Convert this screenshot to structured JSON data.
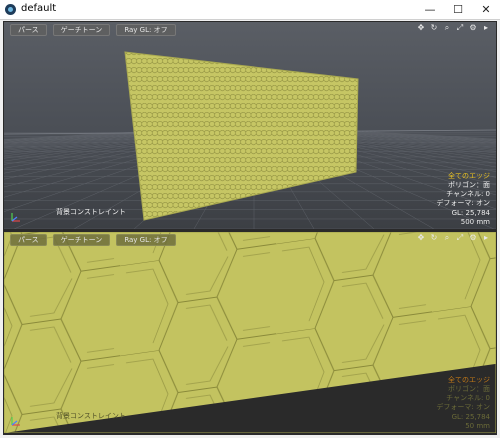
{
  "window": {
    "title": "default",
    "minimize": "—",
    "maximize": "☐",
    "close": "✕"
  },
  "viewport_top": {
    "toolbar": [
      "パース",
      "ゲーチトーン",
      "Ray GL: オフ"
    ],
    "bottom_label": "背景コンストレイント",
    "info": [
      "全てのエッジ",
      "ポリゴン：面",
      "チャンネル: 0",
      "デフォーマ: オン",
      "GL: 25,784",
      "500 mm"
    ]
  },
  "viewport_bottom": {
    "toolbar": [
      "パース",
      "ゲーチトーン",
      "Ray GL: オフ"
    ],
    "bottom_label": "背景コンストレイント",
    "info": [
      "全てのエッジ",
      "ポリゴン：面",
      "チャンネル: 0",
      "デフォーマ: オン",
      "GL: 25,784",
      "50 mm"
    ]
  },
  "colors": {
    "mesh_fill": "#c8c866",
    "mesh_edge": "#8e8e3e",
    "viewport_bg": "#4d5158",
    "highlight": "#e8c020"
  },
  "icons": [
    "move-view-icon",
    "rotate-view-icon",
    "zoom-view-icon",
    "maximize-view-icon",
    "settings-icon",
    "expand-icon"
  ]
}
